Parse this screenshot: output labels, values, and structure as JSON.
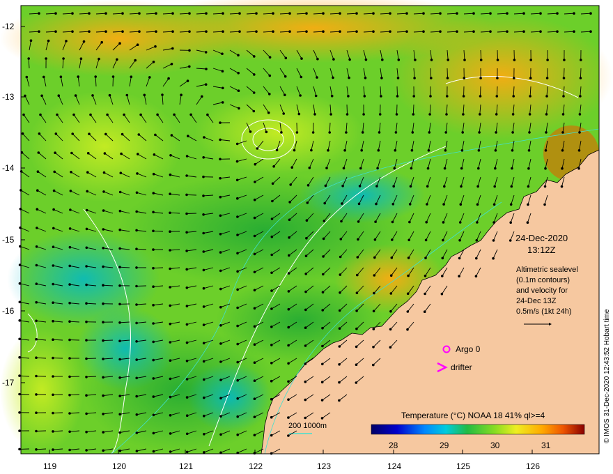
{
  "map": {
    "lat_ticks": [
      "-12",
      "-13",
      "-14",
      "-15",
      "-16",
      "-17"
    ],
    "lon_ticks": [
      "119",
      "120",
      "121",
      "122",
      "123",
      "124",
      "125",
      "126"
    ],
    "date": "24-Dec-2020",
    "time": "13:12Z",
    "legend_lines": [
      "Altimetric sealevel",
      "(0.1m contours)",
      "and velocity for",
      "24-Dec 13Z",
      "0.5m/s (1kt 24h)"
    ],
    "argo_label": "Argo 0",
    "drifter_label": "drifter",
    "isobath_label": "200  1000m",
    "credit": "© IMOS 31-Dec-2020 12:43:52 Hobart time",
    "colorbar": {
      "title": "Temperature (°C) NOAA 18 41% ql>=4",
      "ticks": [
        "28",
        "29",
        "30",
        "31"
      ]
    },
    "colors": {
      "land": "#f6c8a0",
      "argo_marker": "#ff00ff",
      "drifter_marker": "#ff00ff",
      "contour": "#ffffff",
      "isobath": "#40e0d0"
    }
  }
}
